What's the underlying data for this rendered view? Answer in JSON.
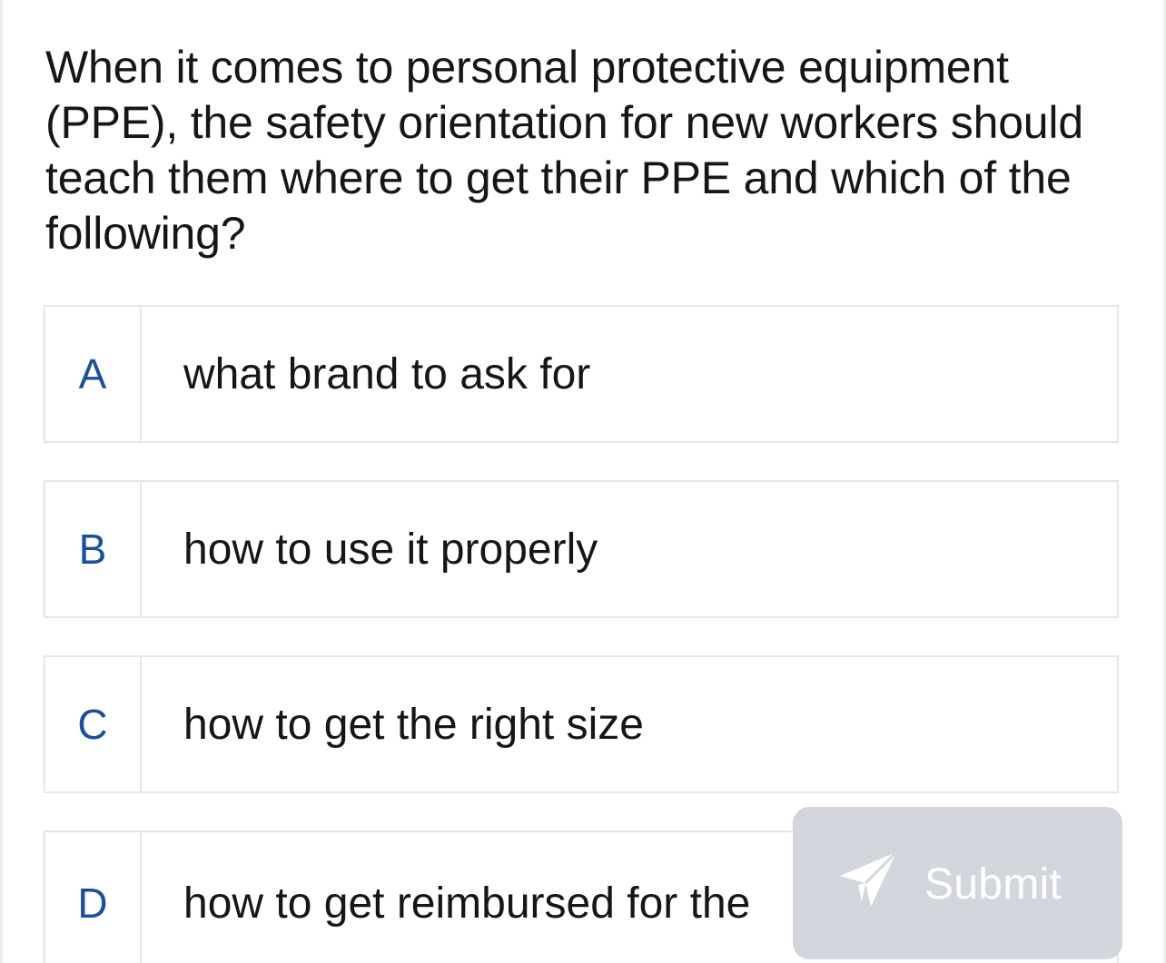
{
  "question": {
    "text": "When it comes to personal protective equipment (PPE), the safety orientation for new workers should teach them where to get their PPE and which of the following?"
  },
  "options": [
    {
      "letter": "A",
      "text": "what brand to ask for"
    },
    {
      "letter": "B",
      "text": "how to use it properly"
    },
    {
      "letter": "C",
      "text": "how to get the right size"
    },
    {
      "letter": "D",
      "text": "how to get reimbursed for the"
    }
  ],
  "submit": {
    "label": "Submit",
    "icon": "send-icon"
  },
  "colors": {
    "accent_letter": "#1b4f9c",
    "submit_bg": "#d3d6dd",
    "border": "#e4e6ea"
  }
}
